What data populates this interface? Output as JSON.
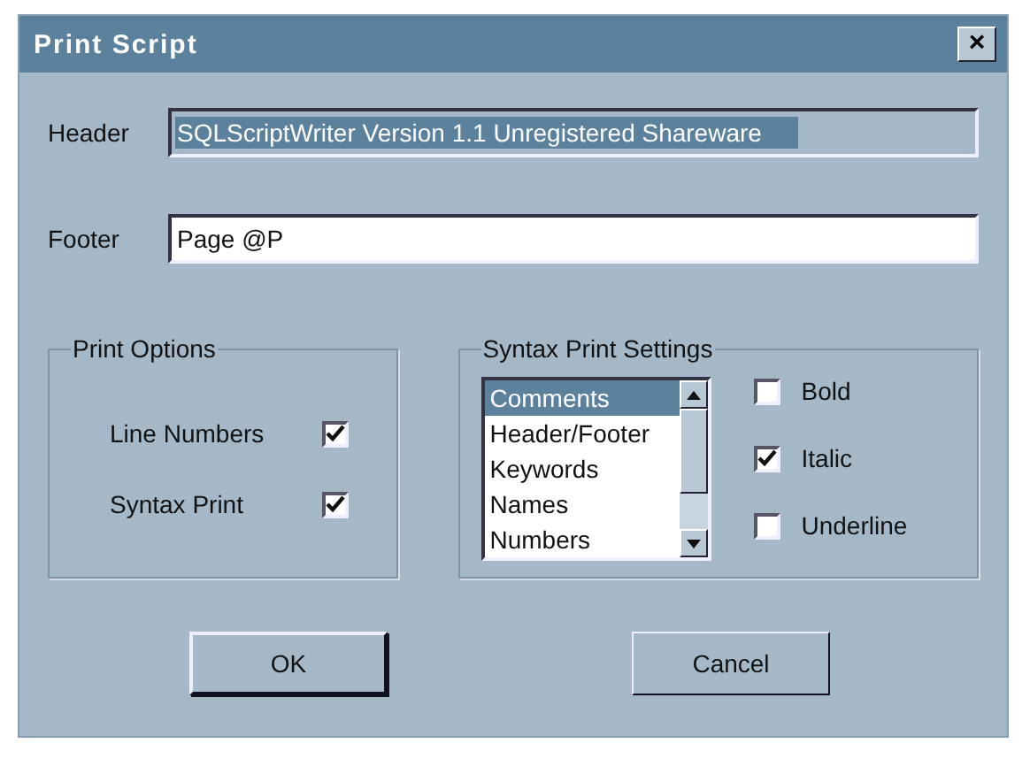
{
  "window": {
    "title": "Print Script",
    "close": "×"
  },
  "header": {
    "label": "Header",
    "value": "SQLScriptWriter Version 1.1 Unregistered Shareware",
    "disabled": true,
    "selected": true
  },
  "footer": {
    "label": "Footer",
    "value": "Page @P",
    "disabled": false,
    "selected": false
  },
  "print_options": {
    "title": "Print Options",
    "options": [
      {
        "label": "Line Numbers",
        "checked": true
      },
      {
        "label": "Syntax Print",
        "checked": true
      }
    ]
  },
  "syntax_settings": {
    "title": "Syntax Print Settings",
    "items": [
      {
        "label": "Comments",
        "selected": true
      },
      {
        "label": "Header/Footer",
        "selected": false
      },
      {
        "label": "Keywords",
        "selected": false
      },
      {
        "label": "Names",
        "selected": false
      },
      {
        "label": "Numbers",
        "selected": false
      }
    ],
    "styles": [
      {
        "label": "Bold",
        "checked": false
      },
      {
        "label": "Italic",
        "checked": true
      },
      {
        "label": "Underline",
        "checked": false
      }
    ]
  },
  "buttons": [
    {
      "label": "OK",
      "default": true
    },
    {
      "label": "Cancel",
      "default": false
    }
  ]
}
